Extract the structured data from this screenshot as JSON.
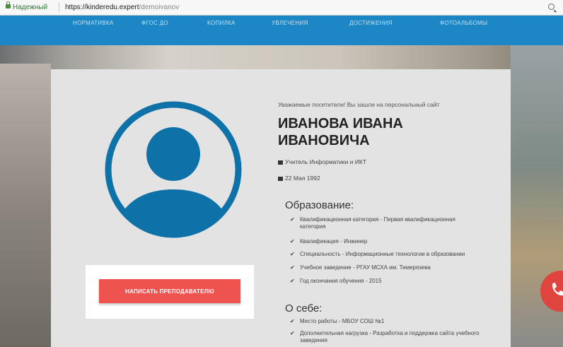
{
  "browser": {
    "secure_label": "Надежный",
    "url_host": "https://kinderedu.expert",
    "url_path": "/demoivanov"
  },
  "nav": {
    "items": [
      "НОРМАТИВКА",
      "ФГОС ДО",
      "КОПИЛКА",
      "УВЛЕЧЕНИЯ",
      "ДОСТИЖЕНИЯ",
      "ФОТОАЛЬБОМЫ"
    ]
  },
  "profile": {
    "greeting": "Уважаемые посетители! Вы зашли на персональный сайт",
    "name_line1": "ИВАНОВА ИВАНА",
    "name_line2": "ИВАНОВИЧА",
    "position": "Учитель Информатики и ИКТ",
    "birthdate": "22 Мая 1992",
    "contact_button": "НАПИСАТЬ ПРЕПОДАВАТЕЛЮ"
  },
  "education": {
    "title": "Образование:",
    "items": [
      "Квалификационная категория - Первая квалификационная категория",
      "Квалификация - Инжинер",
      "Специальность - Информационные технологии в образовании",
      "Учебное заведение - РГАУ МСХА им. Тимерязева",
      "Год окончания обучения - 2015"
    ]
  },
  "about": {
    "title": "О себе:",
    "items": [
      "Место работы - МБОУ СОШ №1",
      "Дополнительная нагрузка - Разработка и поддержка сайта учебного заведения"
    ]
  },
  "colors": {
    "nav": "#1d86c5",
    "avatar": "#0e72a9",
    "cta": "#ef5350",
    "phone_fab": "#e0443f"
  }
}
